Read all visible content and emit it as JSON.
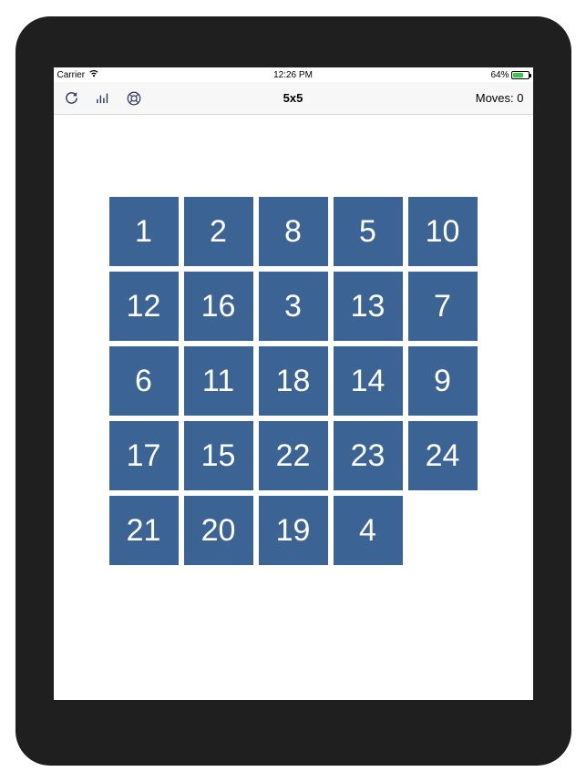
{
  "statusbar": {
    "carrier": "Carrier",
    "time": "12:26 PM",
    "battery_percent": "64%",
    "battery_fill_pct": 64
  },
  "navbar": {
    "title": "5x5",
    "moves_label": "Moves: 0"
  },
  "grid": {
    "cols": 5,
    "rows": 5,
    "tiles": [
      "1",
      "2",
      "8",
      "5",
      "10",
      "12",
      "16",
      "3",
      "13",
      "7",
      "6",
      "11",
      "18",
      "14",
      "9",
      "17",
      "15",
      "22",
      "23",
      "24",
      "21",
      "20",
      "19",
      "4",
      ""
    ]
  },
  "colors": {
    "tile": "#3b6495",
    "nav_icon": "#2e3460",
    "navbar_bg": "#f7f7f8"
  }
}
